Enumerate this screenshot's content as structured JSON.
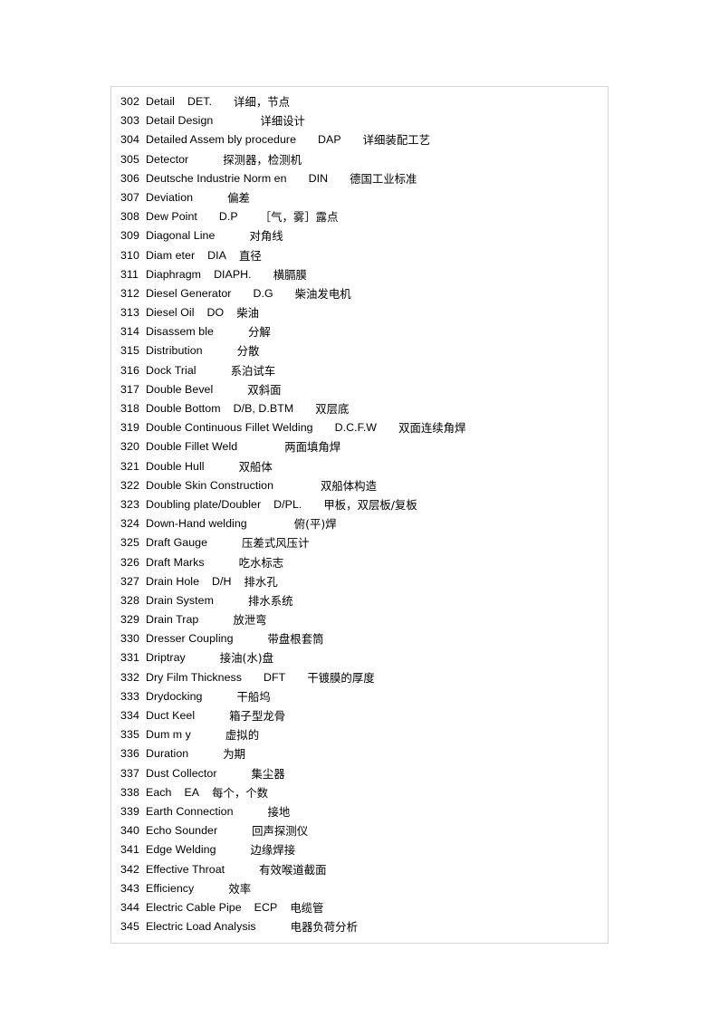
{
  "document": {
    "type": "glossary-table",
    "description": "Bilingual shipbuilding / engineering terminology glossary, English terms with abbreviations and Chinese translations",
    "border_color": "#d4d4d4",
    "background_color": "#ffffff",
    "text_color": "#000000",
    "entries": [
      {
        "no": "302",
        "term": "Detail",
        "abbr": "DET.",
        "cn": "详细，节点",
        "gap1": "gap-sm",
        "gap2": "gap-md"
      },
      {
        "no": "303",
        "term": "Detail Design",
        "abbr": "",
        "cn": "详细设计",
        "gap1": "",
        "gap2": "gap-xl"
      },
      {
        "no": "304",
        "term": "Detailed Assem bly procedure",
        "abbr": "DAP",
        "cn": "详细装配工艺",
        "gap1": "gap-md",
        "gap2": "gap-md"
      },
      {
        "no": "305",
        "term": "Detector",
        "abbr": "",
        "cn": "探测器，检测机",
        "gap1": "",
        "gap2": "gap-lg"
      },
      {
        "no": "306",
        "term": "Deutsche Industrie Norm en",
        "abbr": "DIN",
        "cn": "德国工业标准",
        "gap1": "gap-md",
        "gap2": "gap-md"
      },
      {
        "no": "307",
        "term": "Deviation",
        "abbr": "",
        "cn": "偏差",
        "gap1": "",
        "gap2": "gap-lg"
      },
      {
        "no": "308",
        "term": "Dew Point",
        "abbr": "D.P",
        "cn": "［气，雾］露点",
        "gap1": "gap-md",
        "gap2": "gap-md"
      },
      {
        "no": "309",
        "term": "Diagonal Line",
        "abbr": "",
        "cn": "对角线",
        "gap1": "",
        "gap2": "gap-lg"
      },
      {
        "no": "310",
        "term": "Diam eter",
        "abbr": "DIA",
        "cn": "直径",
        "gap1": "gap-sm",
        "gap2": "gap-sm"
      },
      {
        "no": "311",
        "term": "Diaphragm",
        "abbr": "DIAPH.",
        "cn": "横膈膜",
        "gap1": "gap-sm",
        "gap2": "gap-md"
      },
      {
        "no": "312",
        "term": "Diesel Generator",
        "abbr": "D.G",
        "cn": "柴油发电机",
        "gap1": "gap-md",
        "gap2": "gap-md"
      },
      {
        "no": "313",
        "term": "Diesel Oil",
        "abbr": "DO",
        "cn": "柴油",
        "gap1": "gap-sm",
        "gap2": "gap-sm"
      },
      {
        "no": "314",
        "term": "Disassem ble",
        "abbr": "",
        "cn": "分解",
        "gap1": "",
        "gap2": "gap-lg"
      },
      {
        "no": "315",
        "term": "Distribution",
        "abbr": "",
        "cn": "分散",
        "gap1": "",
        "gap2": "gap-lg"
      },
      {
        "no": "316",
        "term": "Dock Trial",
        "abbr": "",
        "cn": "系泊试车",
        "gap1": "",
        "gap2": "gap-lg"
      },
      {
        "no": "317",
        "term": "Double Bevel",
        "abbr": "",
        "cn": "双斜面",
        "gap1": "",
        "gap2": "gap-lg"
      },
      {
        "no": "318",
        "term": "Double Bottom",
        "abbr": "D/B, D.BTM",
        "cn": "双层底",
        "gap1": "gap-sm",
        "gap2": "gap-md"
      },
      {
        "no": "319",
        "term": "Double Continuous Fillet Welding",
        "abbr": "D.C.F.W",
        "cn": "双面连续角焊",
        "gap1": "gap-md",
        "gap2": "gap-md"
      },
      {
        "no": "320",
        "term": "Double Fillet Weld",
        "abbr": "",
        "cn": "两面填角焊",
        "gap1": "",
        "gap2": "gap-xl"
      },
      {
        "no": "321",
        "term": "Double Hull",
        "abbr": "",
        "cn": "双船体",
        "gap1": "",
        "gap2": "gap-lg"
      },
      {
        "no": "322",
        "term": "Double Skin Construction",
        "abbr": "",
        "cn": "双船体构造",
        "gap1": "",
        "gap2": "gap-xl"
      },
      {
        "no": "323",
        "term": "Doubling plate/Doubler",
        "abbr": "D/PL.",
        "cn": "甲板，双层板/复板",
        "gap1": "gap-sm",
        "gap2": "gap-md"
      },
      {
        "no": "324",
        "term": "Down-Hand welding",
        "abbr": "",
        "cn": "俯(平)焊",
        "gap1": "",
        "gap2": "gap-xl"
      },
      {
        "no": "325",
        "term": "Draft Gauge",
        "abbr": "",
        "cn": "压差式风压计",
        "gap1": "",
        "gap2": "gap-lg"
      },
      {
        "no": "326",
        "term": "Draft Marks",
        "abbr": "",
        "cn": "吃水标志",
        "gap1": "",
        "gap2": "gap-lg"
      },
      {
        "no": "327",
        "term": "Drain Hole",
        "abbr": "D/H",
        "cn": "排水孔",
        "gap1": "gap-sm",
        "gap2": "gap-sm"
      },
      {
        "no": "328",
        "term": "Drain System",
        "abbr": "",
        "cn": "排水系统",
        "gap1": "",
        "gap2": "gap-lg"
      },
      {
        "no": "329",
        "term": "Drain Trap",
        "abbr": "",
        "cn": "放泄弯",
        "gap1": "",
        "gap2": "gap-lg"
      },
      {
        "no": "330",
        "term": "Dresser Coupling",
        "abbr": "",
        "cn": "带盘根套筒",
        "gap1": "",
        "gap2": "gap-lg"
      },
      {
        "no": "331",
        "term": "Driptray",
        "abbr": "",
        "cn": "接油(水)盘",
        "gap1": "",
        "gap2": "gap-lg"
      },
      {
        "no": "332",
        "term": "Dry Film Thickness",
        "abbr": "DFT",
        "cn": "干镀膜的厚度",
        "gap1": "gap-md",
        "gap2": "gap-md"
      },
      {
        "no": "333",
        "term": "Drydocking",
        "abbr": "",
        "cn": "干船坞",
        "gap1": "",
        "gap2": "gap-lg"
      },
      {
        "no": "334",
        "term": "Duct Keel",
        "abbr": "",
        "cn": "箱子型龙骨",
        "gap1": "",
        "gap2": "gap-lg"
      },
      {
        "no": "335",
        "term": "Dum m y",
        "abbr": "",
        "cn": "虚拟的",
        "gap1": "",
        "gap2": "gap-lg"
      },
      {
        "no": "336",
        "term": "Duration",
        "abbr": "",
        "cn": "为期",
        "gap1": "",
        "gap2": "gap-lg"
      },
      {
        "no": "337",
        "term": "Dust Collector",
        "abbr": "",
        "cn": "集尘器",
        "gap1": "",
        "gap2": "gap-lg"
      },
      {
        "no": "338",
        "term": "Each",
        "abbr": "EA",
        "cn": "每个，个数",
        "gap1": "gap-sm",
        "gap2": "gap-sm"
      },
      {
        "no": "339",
        "term": "Earth Connection",
        "abbr": "",
        "cn": "接地",
        "gap1": "",
        "gap2": "gap-lg"
      },
      {
        "no": "340",
        "term": "Echo Sounder",
        "abbr": "",
        "cn": "回声探测仪",
        "gap1": "",
        "gap2": "gap-lg"
      },
      {
        "no": "341",
        "term": "Edge Welding",
        "abbr": "",
        "cn": "边缘焊接",
        "gap1": "",
        "gap2": "gap-lg"
      },
      {
        "no": "342",
        "term": "Effective Throat",
        "abbr": "",
        "cn": "有效喉道截面",
        "gap1": "",
        "gap2": "gap-lg"
      },
      {
        "no": "343",
        "term": "Efficiency",
        "abbr": "",
        "cn": "效率",
        "gap1": "",
        "gap2": "gap-lg"
      },
      {
        "no": "344",
        "term": "Electric Cable Pipe",
        "abbr": "ECP",
        "cn": "电缆管",
        "gap1": "gap-sm",
        "gap2": "gap-sm"
      },
      {
        "no": "345",
        "term": "Electric Load Analysis",
        "abbr": "",
        "cn": "电器负荷分析",
        "gap1": "",
        "gap2": "gap-lg"
      }
    ]
  }
}
